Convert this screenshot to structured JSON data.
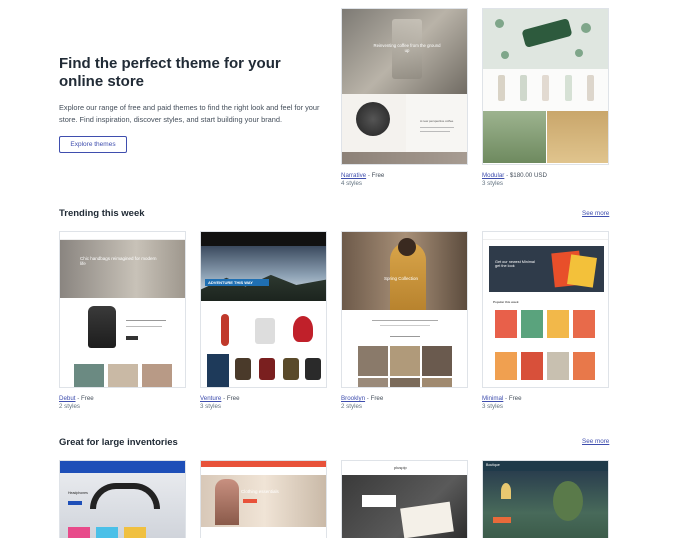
{
  "hero": {
    "title": "Find the perfect theme for your online store",
    "description": "Explore our range of free and paid themes to find the right look and feel for your store. Find inspiration, discover styles, and start building your brand.",
    "button_label": "Explore themes"
  },
  "featured": [
    {
      "name": "Narrative",
      "price": "Free",
      "styles": "4 styles",
      "art_text": "Reinventing coffee from the ground up",
      "art_sub": "A new perspective coffee"
    },
    {
      "name": "Modular",
      "price": "$180.00 USD",
      "styles": "3 styles"
    }
  ],
  "sections": [
    {
      "title": "Trending this week",
      "see_more": "See more",
      "themes": [
        {
          "name": "Debut",
          "price": "Free",
          "styles": "2 styles",
          "art_text": "Chic handbags reimagined for modern life"
        },
        {
          "name": "Venture",
          "price": "Free",
          "styles": "3 styles",
          "art_text": "ADVENTURE THIS WAY"
        },
        {
          "name": "Brooklyn",
          "price": "Free",
          "styles": "2 styles",
          "art_text": "Spring Collection"
        },
        {
          "name": "Minimal",
          "price": "Free",
          "styles": "3 styles",
          "art_text": "Get our newest Minimal get the look"
        }
      ]
    },
    {
      "title": "Great for large inventories",
      "see_more": "See more",
      "themes": [
        {
          "art_text": "Headphones"
        },
        {
          "art_text": "Clothing essentials"
        },
        {
          "art_text": "pluspip"
        },
        {
          "art_text": "Boutique"
        }
      ]
    }
  ],
  "colors": {
    "link": "#3f4eae",
    "heading": "#212b36",
    "body": "#454f5b",
    "border": "#dfe3e8"
  }
}
